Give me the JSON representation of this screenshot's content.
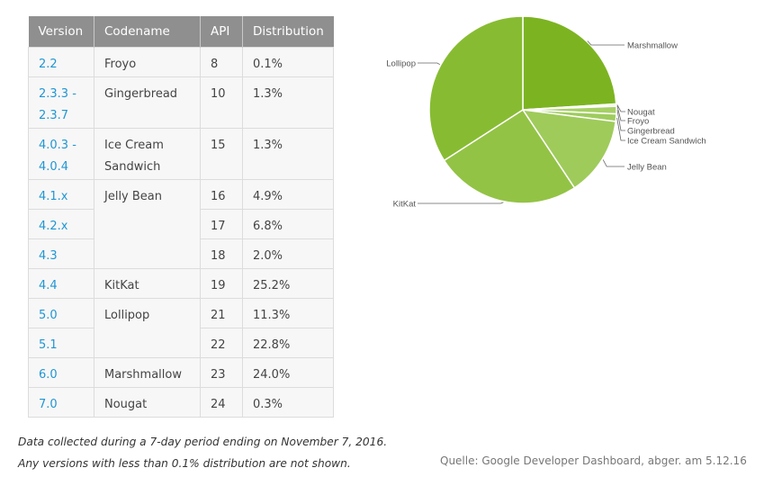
{
  "table": {
    "headers": [
      "Version",
      "Codename",
      "API",
      "Distribution"
    ],
    "rows": [
      {
        "version": "2.2",
        "codename": "Froyo",
        "api": "8",
        "distribution": "0.1%"
      },
      {
        "version": "2.3.3 - 2.3.7",
        "codename": "Gingerbread",
        "api": "10",
        "distribution": "1.3%"
      },
      {
        "version": "4.0.3 - 4.0.4",
        "codename": "Ice Cream Sandwich",
        "api": "15",
        "distribution": "1.3%"
      },
      {
        "version": "4.1.x",
        "codename": "Jelly Bean",
        "api": "16",
        "distribution": "4.9%"
      },
      {
        "version": "4.2.x",
        "codename": "",
        "api": "17",
        "distribution": "6.8%"
      },
      {
        "version": "4.3",
        "codename": "",
        "api": "18",
        "distribution": "2.0%"
      },
      {
        "version": "4.4",
        "codename": "KitKat",
        "api": "19",
        "distribution": "25.2%"
      },
      {
        "version": "5.0",
        "codename": "Lollipop",
        "api": "21",
        "distribution": "11.3%"
      },
      {
        "version": "5.1",
        "codename": "",
        "api": "22",
        "distribution": "22.8%"
      },
      {
        "version": "6.0",
        "codename": "Marshmallow",
        "api": "23",
        "distribution": "24.0%"
      },
      {
        "version": "7.0",
        "codename": "Nougat",
        "api": "24",
        "distribution": "0.3%"
      }
    ]
  },
  "notes": {
    "line1": "Data collected during a 7-day period ending on November 7, 2016.",
    "line2": "Any versions with less than 0.1% distribution are not shown."
  },
  "source": "Quelle: Google Developer Dashboard, abger. am 5.12.16",
  "colors": {
    "header_bg": "#8f8f8f",
    "version_link": "#2196d3"
  },
  "chart_data": {
    "type": "pie",
    "title": "",
    "start": "top",
    "direction": "clockwise",
    "slices": [
      {
        "label": "Marshmallow",
        "value": 24.0,
        "color": "#7cb421"
      },
      {
        "label": "Nougat",
        "value": 0.3,
        "color": "#a9d46a"
      },
      {
        "label": "Froyo",
        "value": 0.1,
        "color": "#b3d97b"
      },
      {
        "label": "Gingerbread",
        "value": 1.3,
        "color": "#a6d066"
      },
      {
        "label": "Ice Cream Sandwich",
        "value": 1.3,
        "color": "#9fcc5e"
      },
      {
        "label": "Jelly Bean",
        "value": 13.7,
        "color": "#9fcb5b"
      },
      {
        "label": "KitKat",
        "value": 25.2,
        "color": "#93c345"
      },
      {
        "label": "Lollipop",
        "value": 34.1,
        "color": "#87bc32"
      }
    ]
  }
}
